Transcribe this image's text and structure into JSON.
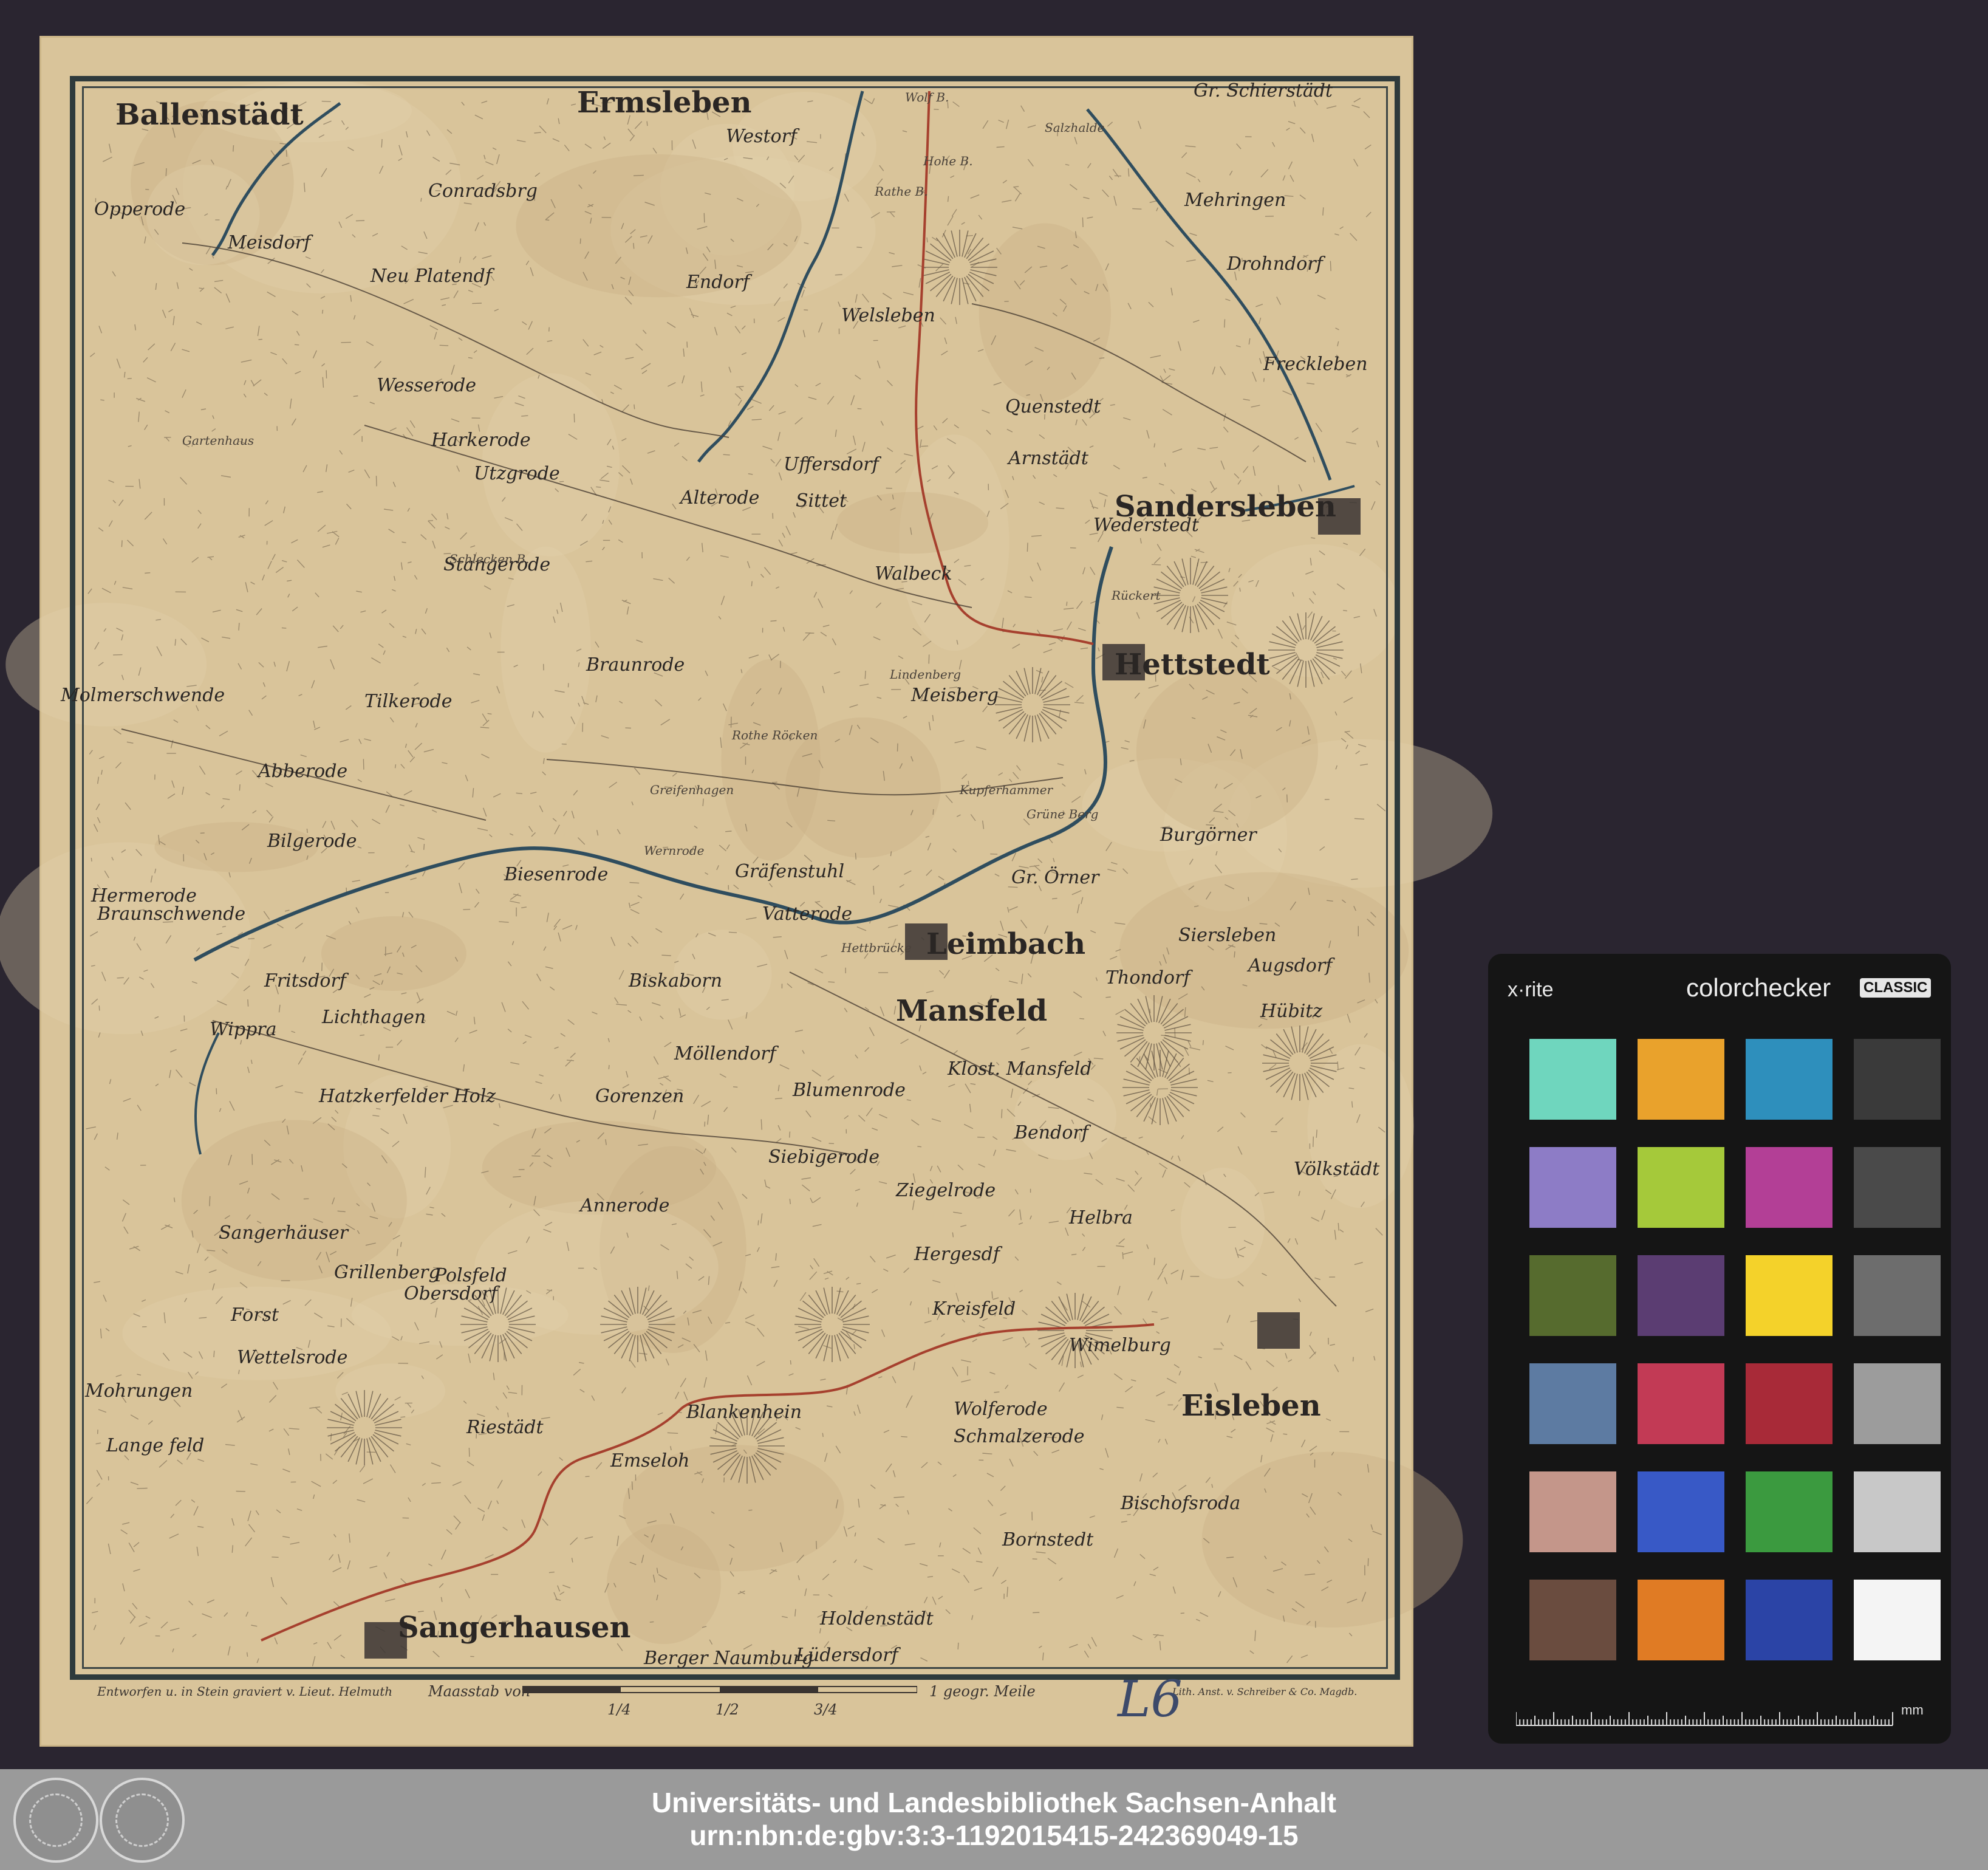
{
  "map": {
    "towns": [
      {
        "name": "Ballenstädt",
        "kind": "town"
      },
      {
        "name": "Ermsleben",
        "kind": "town"
      },
      {
        "name": "Gr. Schierstädt",
        "kind": "village"
      },
      {
        "name": "Mehringen",
        "kind": "village"
      },
      {
        "name": "Drohndorf",
        "kind": "village"
      },
      {
        "name": "Opperode",
        "kind": "village"
      },
      {
        "name": "Conradsbrg",
        "kind": "village"
      },
      {
        "name": "Meisdorf",
        "kind": "village"
      },
      {
        "name": "Neu Platendf",
        "kind": "village"
      },
      {
        "name": "Endorf",
        "kind": "village"
      },
      {
        "name": "Welsleben",
        "kind": "village"
      },
      {
        "name": "Westorf",
        "kind": "village"
      },
      {
        "name": "Freckleben",
        "kind": "village"
      },
      {
        "name": "Wesserode",
        "kind": "village"
      },
      {
        "name": "Quenstedt",
        "kind": "village"
      },
      {
        "name": "Harkerode",
        "kind": "village"
      },
      {
        "name": "Arnstädt",
        "kind": "village"
      },
      {
        "name": "Sandersleben",
        "kind": "town"
      },
      {
        "name": "Utzgrode",
        "kind": "village"
      },
      {
        "name": "Alterode",
        "kind": "village"
      },
      {
        "name": "Uffersdorf",
        "kind": "village"
      },
      {
        "name": "Sittet",
        "kind": "village"
      },
      {
        "name": "Wederstedt",
        "kind": "village"
      },
      {
        "name": "Stangerode",
        "kind": "village"
      },
      {
        "name": "Walbeck",
        "kind": "village"
      },
      {
        "name": "Hettstedt",
        "kind": "town"
      },
      {
        "name": "Braunrode",
        "kind": "village"
      },
      {
        "name": "Molmerschwende",
        "kind": "village"
      },
      {
        "name": "Tilkerode",
        "kind": "village"
      },
      {
        "name": "Meisberg",
        "kind": "village"
      },
      {
        "name": "Abberode",
        "kind": "village"
      },
      {
        "name": "Bilgerode",
        "kind": "village"
      },
      {
        "name": "Burgörner",
        "kind": "village"
      },
      {
        "name": "Biesenrode",
        "kind": "village"
      },
      {
        "name": "Gräfenstuhl",
        "kind": "village"
      },
      {
        "name": "Gr. Örner",
        "kind": "village"
      },
      {
        "name": "Hermerode",
        "kind": "village"
      },
      {
        "name": "Braunschwende",
        "kind": "village"
      },
      {
        "name": "Vatterode",
        "kind": "village"
      },
      {
        "name": "Leimbach",
        "kind": "town"
      },
      {
        "name": "Siersleben",
        "kind": "village"
      },
      {
        "name": "Thondorf",
        "kind": "village"
      },
      {
        "name": "Augsdorf",
        "kind": "village"
      },
      {
        "name": "Fritsdorf",
        "kind": "village"
      },
      {
        "name": "Biskaborn",
        "kind": "village"
      },
      {
        "name": "Mansfeld",
        "kind": "town"
      },
      {
        "name": "Hübitz",
        "kind": "village"
      },
      {
        "name": "Lichthagen",
        "kind": "village"
      },
      {
        "name": "Wippra",
        "kind": "village"
      },
      {
        "name": "Möllendorf",
        "kind": "village"
      },
      {
        "name": "Klost. Mansfeld",
        "kind": "village"
      },
      {
        "name": "Hatzkerfelder Holz",
        "kind": "village"
      },
      {
        "name": "Gorenzen",
        "kind": "village"
      },
      {
        "name": "Blumenrode",
        "kind": "village"
      },
      {
        "name": "Bendorf",
        "kind": "village"
      },
      {
        "name": "Siebigerode",
        "kind": "village"
      },
      {
        "name": "Völkstädt",
        "kind": "village"
      },
      {
        "name": "Annerode",
        "kind": "village"
      },
      {
        "name": "Ziegelrode",
        "kind": "village"
      },
      {
        "name": "Helbra",
        "kind": "village"
      },
      {
        "name": "Sangerhäuser",
        "kind": "village"
      },
      {
        "name": "Hergesdf",
        "kind": "village"
      },
      {
        "name": "Grillenberg",
        "kind": "village"
      },
      {
        "name": "Polsfeld",
        "kind": "village"
      },
      {
        "name": "Obersdorf",
        "kind": "village"
      },
      {
        "name": "Forst",
        "kind": "village"
      },
      {
        "name": "Kreisfeld",
        "kind": "village"
      },
      {
        "name": "Wimelburg",
        "kind": "village"
      },
      {
        "name": "Wettelsrode",
        "kind": "village"
      },
      {
        "name": "Mohrungen",
        "kind": "village"
      },
      {
        "name": "Blankenhein",
        "kind": "village"
      },
      {
        "name": "Wolferode",
        "kind": "village"
      },
      {
        "name": "Eisleben",
        "kind": "town"
      },
      {
        "name": "Lange feld",
        "kind": "village"
      },
      {
        "name": "Riestädt",
        "kind": "village"
      },
      {
        "name": "Emseloh",
        "kind": "village"
      },
      {
        "name": "Schmalzerode",
        "kind": "village"
      },
      {
        "name": "Bischofsroda",
        "kind": "village"
      },
      {
        "name": "Holdenstädt",
        "kind": "village"
      },
      {
        "name": "Bornstedt",
        "kind": "village"
      },
      {
        "name": "Sangerhausen",
        "kind": "town"
      },
      {
        "name": "Berger Naumburg",
        "kind": "village"
      },
      {
        "name": "Lüdersdorf",
        "kind": "village"
      }
    ],
    "features": [
      "Gartenhaus",
      "Rothe Röcken",
      "Lindenberg",
      "Greifenhagen",
      "Wernrode",
      "Hettbrücke",
      "Wolf B.",
      "Hohe B.",
      "Rathe B.",
      "Grüne Berg",
      "Schlecken B.",
      "Kupferhammer",
      "Rückert",
      "Salzhalde"
    ],
    "footer_left": "Entworfen u. in Stein graviert v. Lieut. Helmuth",
    "scale_text": "Maasstab von",
    "scale_ticks": [
      "1/4",
      "1/2",
      "3/4"
    ],
    "scale_unit": "1 geogr. Meile",
    "footer_right": "Lith. Anst. v. Schreiber & Co. Magdb.",
    "shelfmark": "L6"
  },
  "banner": {
    "line1": "Universitäts- und Landesbibliothek Sachsen-Anhalt",
    "line2": "urn:nbn:de:gbv:3:3-1192015415-242369049-15"
  },
  "colorchecker": {
    "logo": "x·rite",
    "brand": "colorchecker",
    "tag": "CLASSIC",
    "ruler_unit": "mm",
    "patches": [
      "#6fd6be",
      "#e9a22c",
      "#2e8fbc",
      "#3a3a3a",
      "#8d7cc6",
      "#a5c93a",
      "#b33f96",
      "#4a4a4a",
      "#566b2e",
      "#5b3d72",
      "#f4d22a",
      "#6d6d6d",
      "#5d7ba2",
      "#c23a55",
      "#a82a38",
      "#9c9c9c",
      "#c4968a",
      "#3859c6",
      "#3b9a3f",
      "#c8c8c8",
      "#6a4c3f",
      "#e07b24",
      "#2b44a6",
      "#f4f4f4"
    ]
  }
}
